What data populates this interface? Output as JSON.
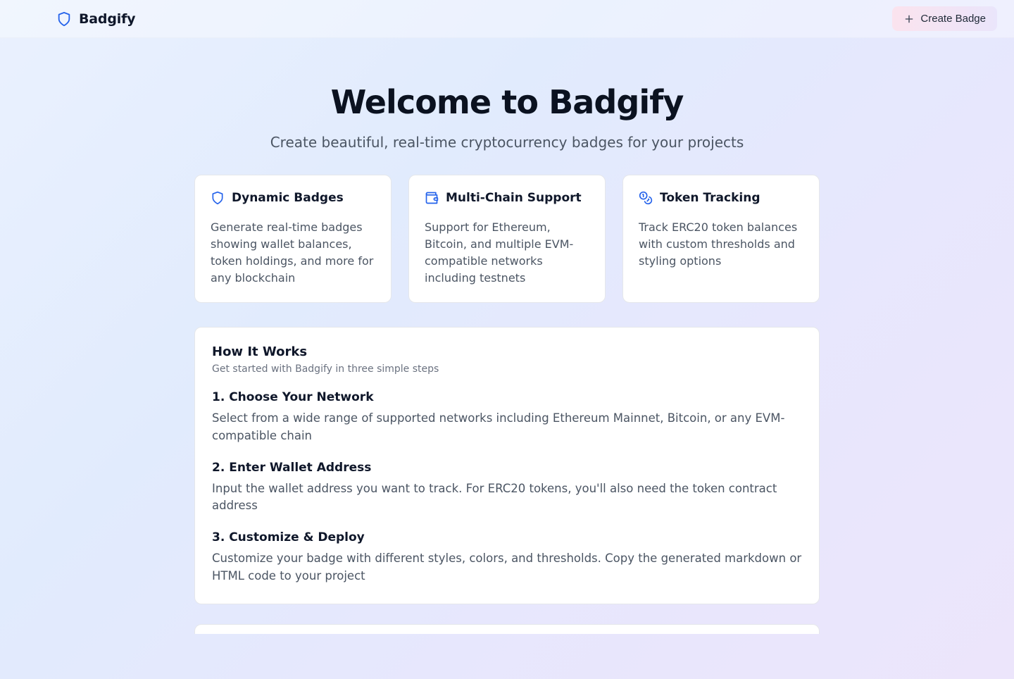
{
  "brand": {
    "name": "Badgify"
  },
  "header": {
    "create_label": "Create Badge"
  },
  "hero": {
    "title": "Welcome to Badgify",
    "subtitle": "Create beautiful, real-time cryptocurrency badges for your projects"
  },
  "features": [
    {
      "title": "Dynamic Badges",
      "desc": "Generate real-time badges showing wallet balances, token holdings, and more for any blockchain"
    },
    {
      "title": "Multi-Chain Support",
      "desc": "Support for Ethereum, Bitcoin, and multiple EVM-compatible networks including testnets"
    },
    {
      "title": "Token Tracking",
      "desc": "Track ERC20 token balances with custom thresholds and styling options"
    }
  ],
  "how": {
    "title": "How It Works",
    "subtitle": "Get started with Badgify in three simple steps",
    "steps": [
      {
        "title": "1. Choose Your Network",
        "desc": "Select from a wide range of supported networks including Ethereum Mainnet, Bitcoin, or any EVM-compatible chain"
      },
      {
        "title": "2. Enter Wallet Address",
        "desc": "Input the wallet address you want to track. For ERC20 tokens, you'll also need the token contract address"
      },
      {
        "title": "3. Customize & Deploy",
        "desc": "Customize your badge with different styles, colors, and thresholds. Copy the generated markdown or HTML code to your project"
      }
    ]
  }
}
